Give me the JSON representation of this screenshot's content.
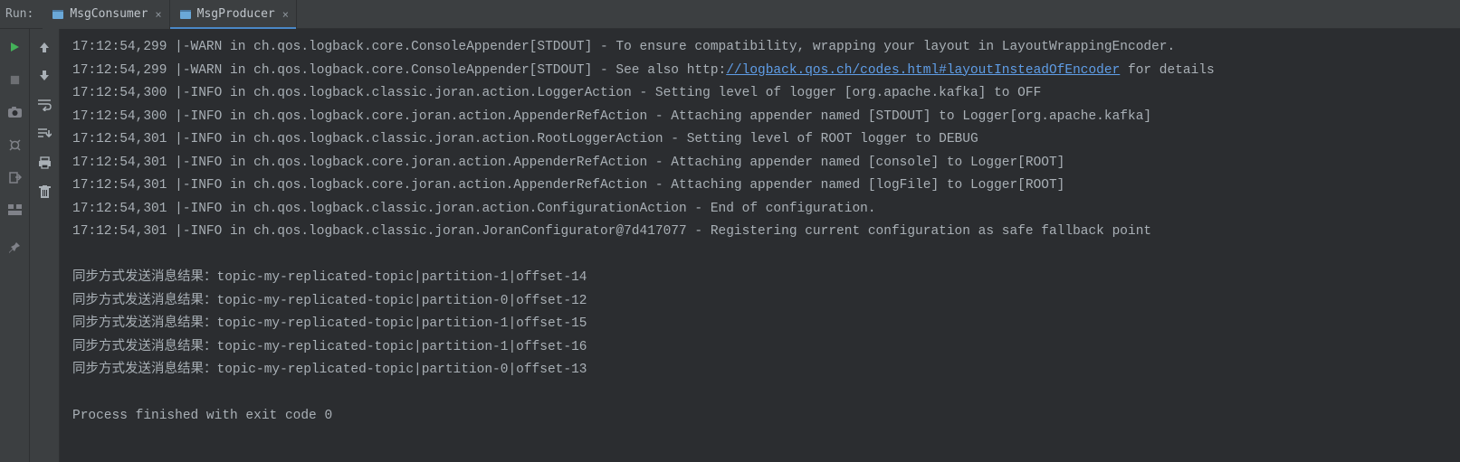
{
  "header": {
    "run_label": "Run:",
    "tabs": [
      {
        "label": "MsgConsumer",
        "active": false
      },
      {
        "label": "MsgProducer",
        "active": true
      }
    ]
  },
  "console": {
    "lines": [
      {
        "type": "log",
        "prefix": "17:12:54,299 |-WARN in ch.qos.logback.core.ConsoleAppender[STDOUT] - To ensure compatibility, wrapping your layout in LayoutWrappingEncoder."
      },
      {
        "type": "log_link",
        "prefix": "17:12:54,299 |-WARN in ch.qos.logback.core.ConsoleAppender[STDOUT] - See also http:",
        "link": "//logback.qos.ch/codes.html#layoutInsteadOfEncoder",
        "suffix": " for details"
      },
      {
        "type": "log",
        "prefix": "17:12:54,300 |-INFO in ch.qos.logback.classic.joran.action.LoggerAction - Setting level of logger [org.apache.kafka] to OFF"
      },
      {
        "type": "log",
        "prefix": "17:12:54,300 |-INFO in ch.qos.logback.core.joran.action.AppenderRefAction - Attaching appender named [STDOUT] to Logger[org.apache.kafka]"
      },
      {
        "type": "log",
        "prefix": "17:12:54,301 |-INFO in ch.qos.logback.classic.joran.action.RootLoggerAction - Setting level of ROOT logger to DEBUG"
      },
      {
        "type": "log",
        "prefix": "17:12:54,301 |-INFO in ch.qos.logback.core.joran.action.AppenderRefAction - Attaching appender named [console] to Logger[ROOT]"
      },
      {
        "type": "log",
        "prefix": "17:12:54,301 |-INFO in ch.qos.logback.core.joran.action.AppenderRefAction - Attaching appender named [logFile] to Logger[ROOT]"
      },
      {
        "type": "log",
        "prefix": "17:12:54,301 |-INFO in ch.qos.logback.classic.joran.action.ConfigurationAction - End of configuration."
      },
      {
        "type": "log",
        "prefix": "17:12:54,301 |-INFO in ch.qos.logback.classic.joran.JoranConfigurator@7d417077 - Registering current configuration as safe fallback point"
      },
      {
        "type": "blank"
      },
      {
        "type": "log",
        "prefix": "同步方式发送消息结果：topic-my-replicated-topic|partition-1|offset-14"
      },
      {
        "type": "log",
        "prefix": "同步方式发送消息结果：topic-my-replicated-topic|partition-0|offset-12"
      },
      {
        "type": "log",
        "prefix": "同步方式发送消息结果：topic-my-replicated-topic|partition-1|offset-15"
      },
      {
        "type": "log",
        "prefix": "同步方式发送消息结果：topic-my-replicated-topic|partition-1|offset-16"
      },
      {
        "type": "log",
        "prefix": "同步方式发送消息结果：topic-my-replicated-topic|partition-0|offset-13"
      },
      {
        "type": "blank"
      },
      {
        "type": "log",
        "prefix": "Process finished with exit code 0"
      }
    ]
  }
}
